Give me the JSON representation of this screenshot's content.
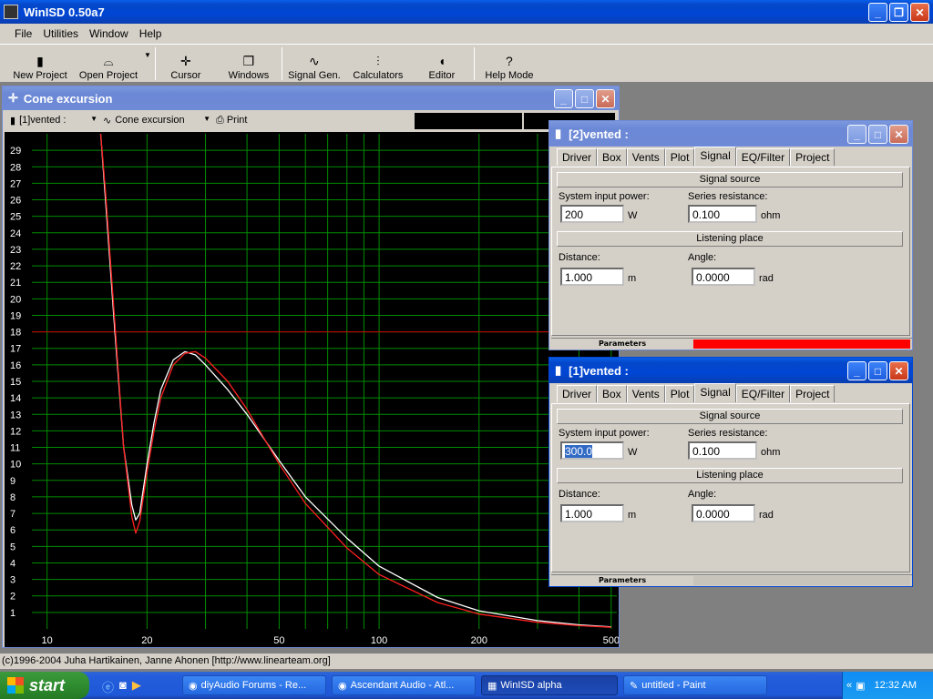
{
  "app": {
    "title": "WinISD 0.50a7",
    "copyright": "(c)1996-2004 Juha Hartikainen, Janne Ahonen [http://www.linearteam.org]"
  },
  "menu": [
    "File",
    "Utilities",
    "Window",
    "Help"
  ],
  "toolbar": [
    {
      "label": "New Project",
      "icon": "new-project-icon"
    },
    {
      "label": "Open Project",
      "icon": "open-folder-icon"
    },
    {
      "label": "Cursor",
      "icon": "cursor-icon"
    },
    {
      "label": "Windows",
      "icon": "windows-icon"
    },
    {
      "label": "Signal Gen.",
      "icon": "sine-wave-icon"
    },
    {
      "label": "Calculators",
      "icon": "calculator-icon"
    },
    {
      "label": "Editor",
      "icon": "speaker-editor-icon"
    },
    {
      "label": "Help Mode",
      "icon": "question-icon"
    }
  ],
  "plot_window": {
    "title": "Cone excursion",
    "project_select": "[1]vented :",
    "graph_select": "Cone excursion",
    "print_label": "Print"
  },
  "chart_data": {
    "type": "line",
    "title": "",
    "xlabel": "",
    "ylabel": "",
    "xscale": "log",
    "xlim": [
      9,
      520
    ],
    "ylim": [
      0,
      30
    ],
    "x_ticks": [
      10,
      20,
      50,
      100,
      200,
      500
    ],
    "y_ticks": [
      1,
      2,
      3,
      4,
      5,
      6,
      7,
      8,
      9,
      10,
      11,
      12,
      13,
      14,
      15,
      16,
      17,
      18,
      19,
      20,
      21,
      22,
      23,
      24,
      25,
      26,
      27,
      28,
      29
    ],
    "reference_line": {
      "y": 18,
      "color": "#cc0000"
    },
    "grid": true,
    "series": [
      {
        "color": "#ffffff",
        "x": [
          14.5,
          15,
          16,
          17,
          18,
          18.5,
          19,
          19.5,
          20,
          21,
          22,
          24,
          26,
          28,
          30,
          35,
          40,
          50,
          60,
          80,
          100,
          150,
          200,
          300,
          400,
          500
        ],
        "y": [
          30,
          26,
          18,
          11,
          7.5,
          6.6,
          7,
          8.5,
          10,
          12.5,
          14.5,
          16.3,
          16.8,
          16.6,
          16,
          14.5,
          13,
          10.2,
          8,
          5.5,
          3.8,
          1.9,
          1.1,
          0.5,
          0.25,
          0.12
        ]
      },
      {
        "color": "#ff2020",
        "x": [
          14.5,
          15,
          16,
          17,
          18,
          18.5,
          19,
          19.5,
          20,
          21,
          22,
          24,
          26,
          28,
          30,
          35,
          40,
          50,
          60,
          80,
          100,
          150,
          200,
          300,
          400,
          500
        ],
        "y": [
          30,
          26.5,
          18.5,
          11,
          6.8,
          5.8,
          6.5,
          8,
          9.5,
          12,
          14,
          16,
          16.7,
          16.8,
          16.4,
          15,
          13.3,
          10,
          7.6,
          4.9,
          3.3,
          1.6,
          0.9,
          0.4,
          0.2,
          0.1
        ]
      }
    ]
  },
  "tabs": [
    "Driver",
    "Box",
    "Vents",
    "Plot",
    "Signal",
    "EQ/Filter",
    "Project"
  ],
  "dialog2": {
    "title": "[2]vented :",
    "signal_source": "Signal source",
    "power_label": "System input power:",
    "power_value": "200",
    "power_unit": "W",
    "res_label": "Series resistance:",
    "res_value": "0.100",
    "res_unit": "ohm",
    "listening": "Listening place",
    "dist_label": "Distance:",
    "dist_value": "1.000",
    "dist_unit": "m",
    "angle_label": "Angle:",
    "angle_value": "0.0000",
    "angle_unit": "rad",
    "status": "Parameters"
  },
  "dialog1": {
    "title": "[1]vented :",
    "signal_source": "Signal source",
    "power_label": "System input power:",
    "power_value": "300.0",
    "power_unit": "W",
    "res_label": "Series resistance:",
    "res_value": "0.100",
    "res_unit": "ohm",
    "listening": "Listening place",
    "dist_label": "Distance:",
    "dist_value": "1.000",
    "dist_unit": "m",
    "angle_label": "Angle:",
    "angle_value": "0.0000",
    "angle_unit": "rad",
    "status": "Parameters"
  },
  "taskbar": {
    "start": "start",
    "items": [
      "diyAudio Forums - Re...",
      "Ascendant Audio - Atl...",
      "WinISD alpha",
      "untitled - Paint"
    ],
    "clock": "12:32 AM"
  }
}
